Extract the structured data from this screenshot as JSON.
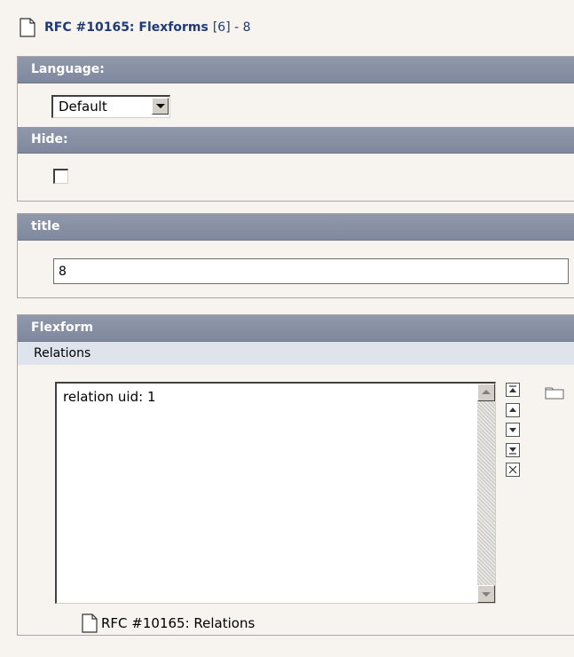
{
  "header": {
    "title": "RFC #10165: Flexforms",
    "meta": "[6] - 8",
    "icon": "document-icon"
  },
  "language_panel": {
    "label": "Language:",
    "select_value": "Default",
    "hide_label": "Hide:",
    "hide_checked": false
  },
  "title_panel": {
    "label": "title",
    "value": "8"
  },
  "flexform_panel": {
    "label": "Flexform",
    "section": "Relations",
    "items": [
      "relation uid: 1"
    ],
    "controls": [
      "move-to-top-icon",
      "move-up-icon",
      "move-down-icon",
      "move-to-bottom-icon",
      "remove-icon"
    ],
    "browse_icon": "folder-icon",
    "reference": "RFC #10165: Relations"
  }
}
